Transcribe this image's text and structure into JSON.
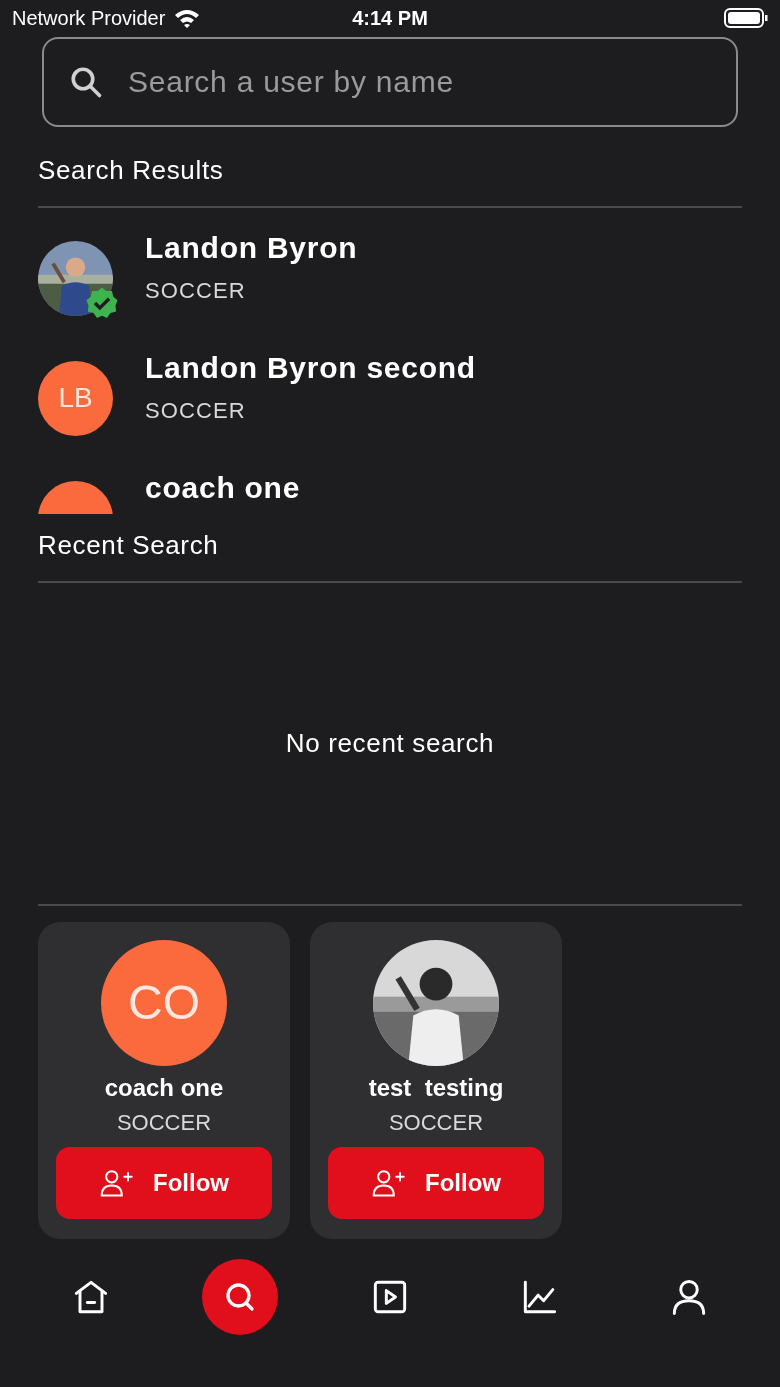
{
  "status_bar": {
    "carrier": "Network Provider",
    "time": "4:14 PM"
  },
  "search": {
    "placeholder": "Search a user by name"
  },
  "results": {
    "title": "Search Results",
    "items": [
      {
        "name": "Landon Byron",
        "sport": "SOCCER",
        "kind": "picture",
        "verified": true
      },
      {
        "name": "Landon Byron second",
        "sport": "SOCCER",
        "kind": "initials",
        "initials": "LB",
        "verified": false
      },
      {
        "name": "coach one",
        "kind": "initials",
        "verified": false
      }
    ]
  },
  "recent": {
    "title": "Recent Search",
    "empty_text": "No recent search"
  },
  "suggestions": [
    {
      "name": "coach one",
      "sport": "SOCCER",
      "kind": "initials",
      "initials": "CO",
      "button": "Follow"
    },
    {
      "name": "test  testing",
      "sport": "SOCCER",
      "kind": "picture",
      "button": "Follow"
    }
  ],
  "nav": [
    {
      "kind": "home",
      "selected": false
    },
    {
      "kind": "search",
      "selected": true
    },
    {
      "kind": "video",
      "selected": false
    },
    {
      "kind": "stats",
      "selected": false
    },
    {
      "kind": "profile",
      "selected": false
    }
  ]
}
